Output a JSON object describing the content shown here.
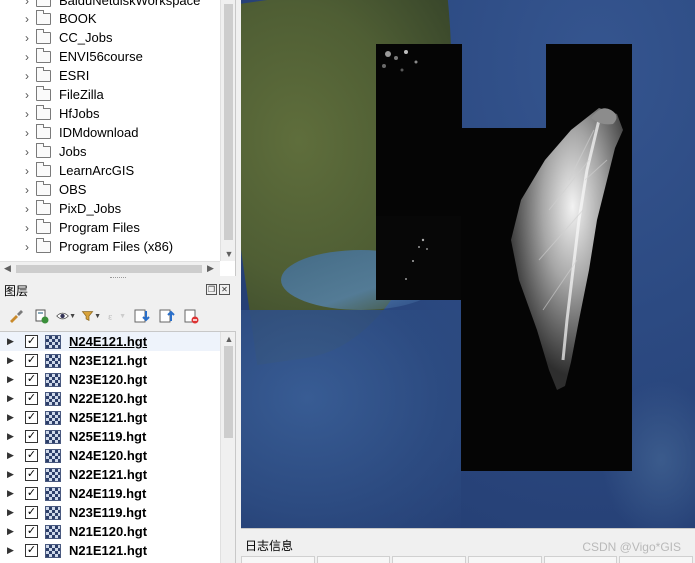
{
  "browser": {
    "items": [
      {
        "label": "BaiduNetdiskWorkspace"
      },
      {
        "label": "BOOK"
      },
      {
        "label": "CC_Jobs"
      },
      {
        "label": "ENVI56course"
      },
      {
        "label": "ESRI"
      },
      {
        "label": "FileZilla"
      },
      {
        "label": "HfJobs"
      },
      {
        "label": "IDMdownload"
      },
      {
        "label": "Jobs"
      },
      {
        "label": "LearnArcGIS"
      },
      {
        "label": "OBS"
      },
      {
        "label": "PixD_Jobs"
      },
      {
        "label": "Program Files"
      },
      {
        "label": "Program Files (x86)"
      }
    ]
  },
  "layers": {
    "title": "图层",
    "float_glyph": "❐",
    "close_glyph": "✕",
    "items": [
      {
        "name": "N24E121.hgt",
        "checked": true,
        "selected": true
      },
      {
        "name": "N23E121.hgt",
        "checked": true
      },
      {
        "name": "N23E120.hgt",
        "checked": true
      },
      {
        "name": "N22E120.hgt",
        "checked": true
      },
      {
        "name": "N25E121.hgt",
        "checked": true
      },
      {
        "name": "N25E119.hgt",
        "checked": true
      },
      {
        "name": "N24E120.hgt",
        "checked": true
      },
      {
        "name": "N22E121.hgt",
        "checked": true
      },
      {
        "name": "N24E119.hgt",
        "checked": true
      },
      {
        "name": "N23E119.hgt",
        "checked": true
      },
      {
        "name": "N21E120.hgt",
        "checked": true
      },
      {
        "name": "N21E121.hgt",
        "checked": true
      }
    ],
    "toolbar_icons": [
      "style-brush-icon",
      "add-group-icon",
      "eye-icon",
      "filter-icon",
      "filter-expression-icon",
      "expand-all-icon",
      "collapse-all-icon",
      "remove-layer-icon"
    ]
  },
  "log": {
    "title": "日志信息"
  },
  "watermark": "CSDN @Vigo*GIS",
  "glyphs": {
    "expand": "›",
    "collapse": "›",
    "check": "✓",
    "up": "▲",
    "down": "▼",
    "left": "◀",
    "right": "▶"
  },
  "colors": {
    "sea": "#2c4a82",
    "land": "#4f5e34",
    "tile": "#050505"
  }
}
